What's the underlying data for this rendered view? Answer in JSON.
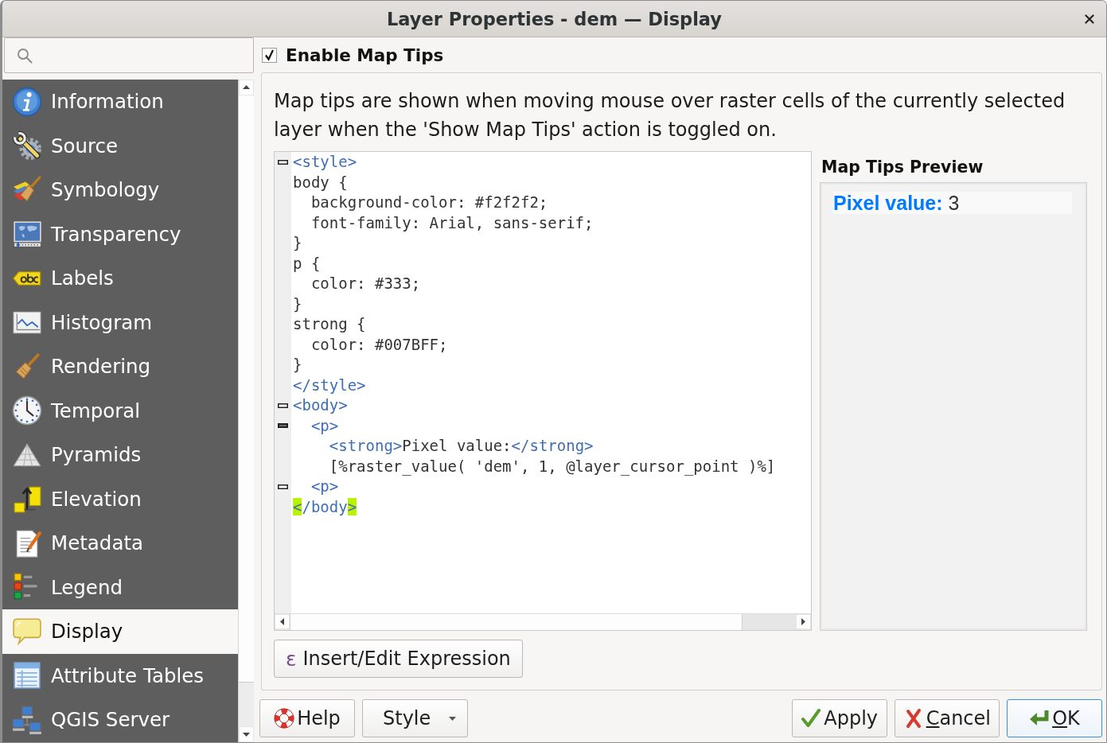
{
  "window": {
    "title": "Layer Properties - dem — Display"
  },
  "sidebar": {
    "items": [
      {
        "label": "Information",
        "selected": false
      },
      {
        "label": "Source",
        "selected": false
      },
      {
        "label": "Symbology",
        "selected": false
      },
      {
        "label": "Transparency",
        "selected": false
      },
      {
        "label": "Labels",
        "selected": false
      },
      {
        "label": "Histogram",
        "selected": false
      },
      {
        "label": "Rendering",
        "selected": false
      },
      {
        "label": "Temporal",
        "selected": false
      },
      {
        "label": "Pyramids",
        "selected": false
      },
      {
        "label": "Elevation",
        "selected": false
      },
      {
        "label": "Metadata",
        "selected": false
      },
      {
        "label": "Legend",
        "selected": false
      },
      {
        "label": "Display",
        "selected": true
      },
      {
        "label": "Attribute Tables",
        "selected": false
      },
      {
        "label": "QGIS Server",
        "selected": false
      }
    ]
  },
  "map_tips": {
    "label": "Enable Map Tips",
    "checked": true,
    "description": "Map tips are shown when moving mouse over raster cells of the currently selected layer when the 'Show Map Tips' action is toggled on.",
    "editor": {
      "lines": [
        {
          "fold": true,
          "filled": false,
          "segments": [
            {
              "kind": "tag",
              "text": "<style>"
            }
          ]
        },
        {
          "fold": false,
          "filled": false,
          "segments": [
            {
              "kind": "text",
              "text": "body {"
            }
          ]
        },
        {
          "fold": false,
          "filled": false,
          "segments": [
            {
              "kind": "text",
              "text": "  background-color: #f2f2f2;"
            }
          ]
        },
        {
          "fold": false,
          "filled": false,
          "segments": [
            {
              "kind": "text",
              "text": "  font-family: Arial, sans-serif;"
            }
          ]
        },
        {
          "fold": false,
          "filled": false,
          "segments": [
            {
              "kind": "text",
              "text": "}"
            }
          ]
        },
        {
          "fold": false,
          "filled": false,
          "segments": [
            {
              "kind": "text",
              "text": "p {"
            }
          ]
        },
        {
          "fold": false,
          "filled": false,
          "segments": [
            {
              "kind": "text",
              "text": "  color: #333;"
            }
          ]
        },
        {
          "fold": false,
          "filled": false,
          "segments": [
            {
              "kind": "text",
              "text": "}"
            }
          ]
        },
        {
          "fold": false,
          "filled": false,
          "segments": [
            {
              "kind": "text",
              "text": "strong {"
            }
          ]
        },
        {
          "fold": false,
          "filled": false,
          "segments": [
            {
              "kind": "text",
              "text": "  color: #007BFF;"
            }
          ]
        },
        {
          "fold": false,
          "filled": false,
          "segments": [
            {
              "kind": "text",
              "text": "}"
            }
          ]
        },
        {
          "fold": false,
          "filled": false,
          "segments": [
            {
              "kind": "tag",
              "text": "</style>"
            }
          ]
        },
        {
          "fold": true,
          "filled": false,
          "segments": [
            {
              "kind": "tag",
              "text": "<body>"
            }
          ]
        },
        {
          "fold": true,
          "filled": true,
          "segments": [
            {
              "kind": "tag",
              "text": "  <p>"
            }
          ]
        },
        {
          "fold": false,
          "filled": false,
          "segments": [
            {
              "kind": "tag",
              "text": "    <strong>"
            },
            {
              "kind": "text",
              "text": "Pixel value:"
            },
            {
              "kind": "tag",
              "text": "</strong>"
            }
          ]
        },
        {
          "fold": false,
          "filled": false,
          "segments": [
            {
              "kind": "text",
              "text": "    [%raster_value( 'dem', 1, @layer_cursor_point )%]"
            }
          ]
        },
        {
          "fold": true,
          "filled": false,
          "segments": [
            {
              "kind": "tag",
              "text": "  <p>"
            }
          ]
        },
        {
          "fold": false,
          "filled": false,
          "segments": [
            {
              "kind": "match",
              "text": "<"
            },
            {
              "kind": "tag",
              "text": "/body"
            },
            {
              "kind": "match",
              "text": ">"
            }
          ]
        }
      ]
    },
    "preview": {
      "title": "Map Tips Preview",
      "content": "**Pixel value:** 3"
    },
    "expression_button": {
      "icon": "ε",
      "label": "Insert/Edit Expression"
    }
  },
  "buttons": {
    "left": [
      {
        "label": "Help",
        "kind": "help",
        "default": false,
        "mnemonic": false
      },
      {
        "label": "Style",
        "kind": "menu",
        "default": false,
        "mnemonic": false
      }
    ],
    "right": [
      {
        "label": "Apply",
        "kind": "apply",
        "default": false,
        "mnemonic": false
      },
      {
        "label": "Cancel",
        "kind": "cancel",
        "default": false,
        "mnemonic": true
      },
      {
        "label": "OK",
        "kind": "ok",
        "default": true,
        "mnemonic": true
      }
    ]
  }
}
